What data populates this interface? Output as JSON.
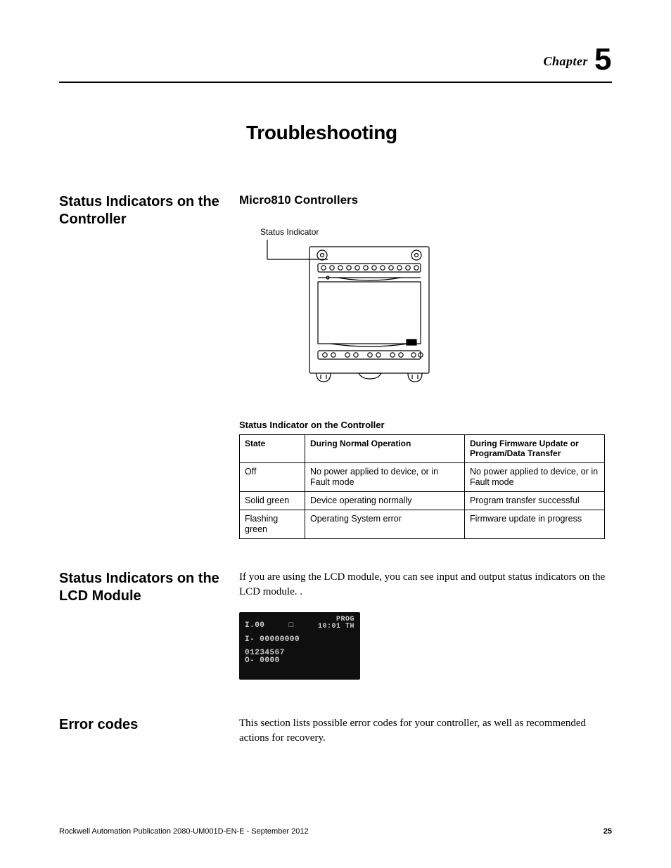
{
  "chapter": {
    "word": "Chapter",
    "number": "5"
  },
  "title": "Troubleshooting",
  "section1": {
    "side": "Status Indicators on the Controller",
    "sub": "Micro810 Controllers",
    "diagram_label": "Status Indicator"
  },
  "table": {
    "title": "Status Indicator on the Controller",
    "headers": {
      "state": "State",
      "normal": "During Normal Operation",
      "fw": "During Firmware Update or Program/Data Transfer"
    },
    "rows": [
      {
        "state": "Off",
        "normal": "No power applied to device, or in Fault mode",
        "fw": "No power applied to device, or in Fault mode"
      },
      {
        "state": "Solid green",
        "normal": "Device operating normally",
        "fw": "Program transfer successful"
      },
      {
        "state": "Flashing green",
        "normal": "Operating System error",
        "fw": "Firmware update in progress"
      }
    ]
  },
  "section2": {
    "side": "Status Indicators on the LCD Module",
    "body": "If you are using the LCD module, you can see input and output status indicators on the LCD module. ."
  },
  "lcd": {
    "topLeft": "I.00",
    "prog1": "PROG",
    "prog2": "10:01 TH",
    "mid": "I- 00000000",
    "bot1": "   01234567",
    "bot2": "O- 0000"
  },
  "section3": {
    "side": "Error codes",
    "body": "This section lists possible error codes for your controller, as well as recommended actions for recovery."
  },
  "footer": {
    "pub": "Rockwell Automation Publication 2080-UM001D-EN-E - September 2012",
    "page": "25"
  }
}
